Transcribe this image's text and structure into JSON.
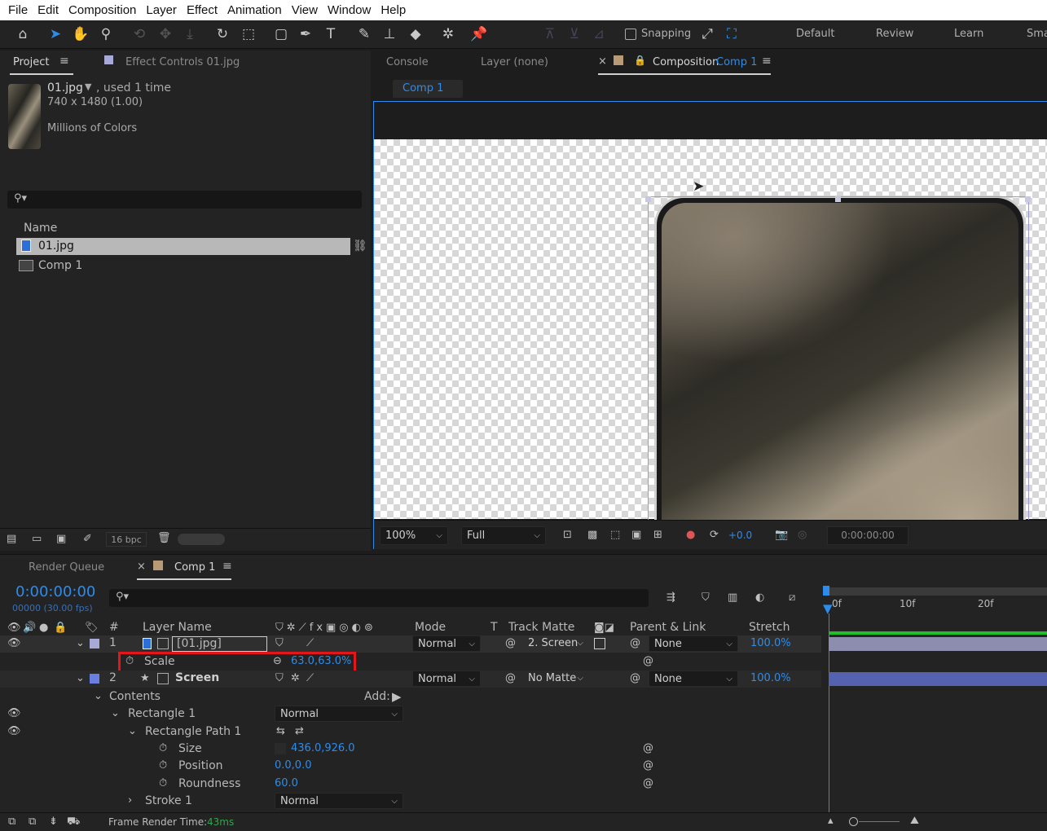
{
  "menu": [
    "File",
    "Edit",
    "Composition",
    "Layer",
    "Effect",
    "Animation",
    "View",
    "Window",
    "Help"
  ],
  "toolbar": {
    "snapping_label": "Snapping",
    "workspaces": [
      "Default",
      "Review",
      "Learn",
      "Sma"
    ]
  },
  "project": {
    "tab_project": "Project",
    "tab_effect_controls": "Effect Controls 01.jpg",
    "item_name": "01.jpg",
    "item_used": ", used 1 time",
    "item_dims": "740 x 1480 (1.00)",
    "item_colors": "Millions of Colors",
    "search_placeholder": "",
    "col_name": "Name",
    "items": [
      "01.jpg",
      "Comp 1"
    ],
    "bpc": "16 bpc"
  },
  "viewer": {
    "tab_console": "Console",
    "tab_layer": "Layer (none)",
    "tab_comp_label": "Composition",
    "tab_comp_name": "Comp 1",
    "breadcrumb": "Comp 1",
    "zoom": "100%",
    "resolution": "Full",
    "exposure": "+0.0",
    "timecode": "0:00:00:00"
  },
  "timeline": {
    "tab_render_queue": "Render Queue",
    "tab_comp": "Comp 1",
    "timecode": "0:00:00:00",
    "frames": "00000 (30.00 fps)",
    "ruler": [
      "0f",
      "10f",
      "20f"
    ],
    "headers": {
      "num": "#",
      "layer_name": "Layer Name",
      "mode": "Mode",
      "t": "T",
      "track_matte": "Track Matte",
      "parent": "Parent & Link",
      "stretch": "Stretch"
    },
    "layer1": {
      "num": "1",
      "name": "[01.jpg]",
      "mode": "Normal",
      "matte": "2. Screen",
      "parent": "None",
      "stretch": "100.0%"
    },
    "scale": {
      "label": "Scale",
      "value": "63.0,63.0%"
    },
    "layer2": {
      "num": "2",
      "name": "Screen",
      "mode": "Normal",
      "matte": "No Matte",
      "parent": "None",
      "stretch": "100.0%"
    },
    "contents": {
      "label": "Contents",
      "add_label": "Add:"
    },
    "rectangle": {
      "label": "Rectangle 1",
      "mode": "Normal"
    },
    "rect_path": {
      "label": "Rectangle Path 1"
    },
    "size": {
      "label": "Size",
      "value": "436.0,926.0"
    },
    "position": {
      "label": "Position",
      "value": "0.0,0.0"
    },
    "roundness": {
      "label": "Roundness",
      "value": "60.0"
    },
    "stroke": {
      "label": "Stroke 1",
      "mode": "Normal"
    },
    "render_time_label": "Frame Render Time:",
    "render_time_value": "43ms"
  },
  "colors": {
    "accent": "#2d8ceb",
    "highlight": "#e3161c",
    "layer1_label": "#a9a9d8",
    "layer2_label": "#6a7fe0"
  }
}
